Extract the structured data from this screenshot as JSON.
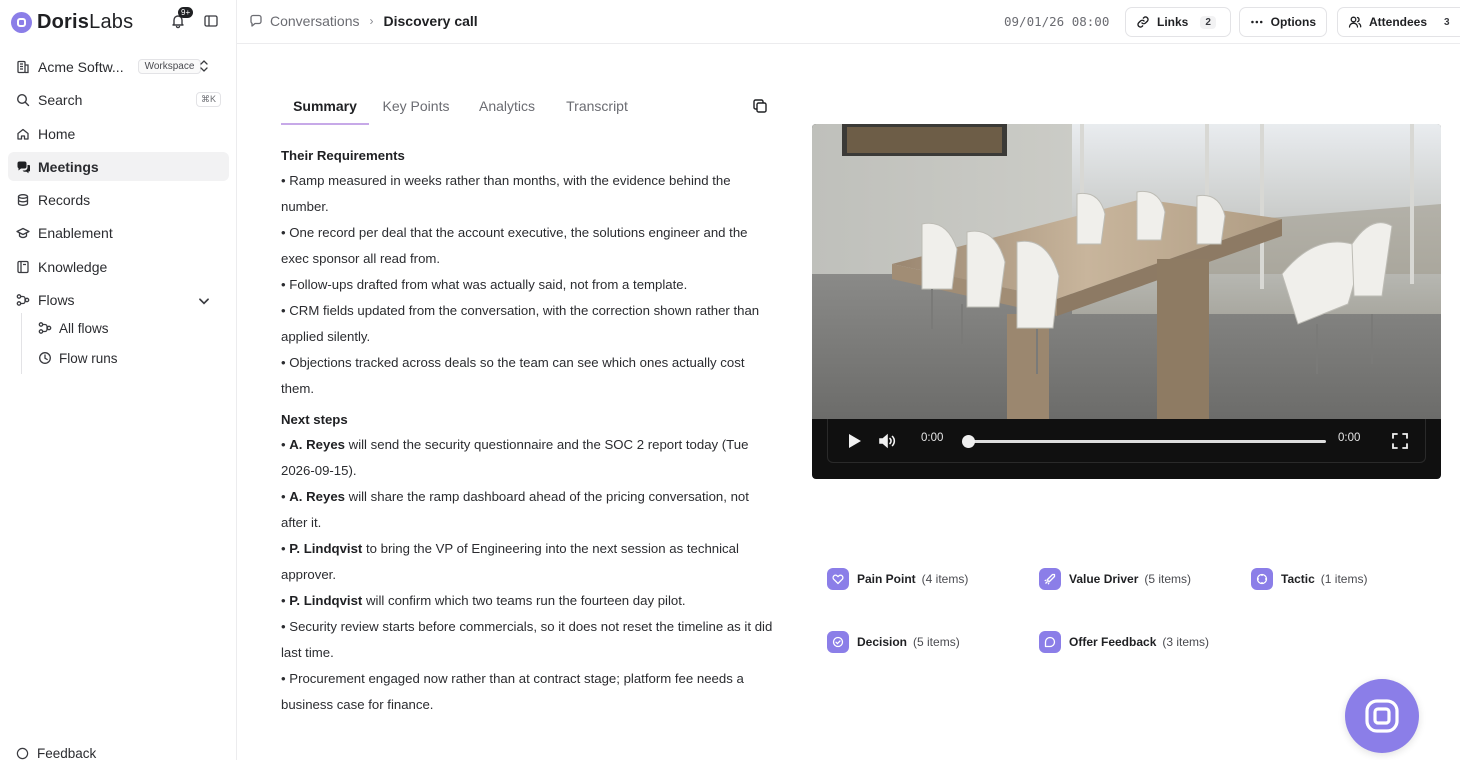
{
  "brand": {
    "name_bold": "Doris",
    "name_rest": "Labs",
    "notifications_badge": "9+"
  },
  "sidebar": {
    "workspace": {
      "name": "Acme Softw...",
      "tag": "Workspace"
    },
    "search": {
      "label": "Search",
      "shortcut": "⌘K"
    },
    "items": [
      {
        "label": "Home",
        "icon": "home-icon"
      },
      {
        "label": "Meetings",
        "icon": "chat-bubbles-icon",
        "active": true
      },
      {
        "label": "Records",
        "icon": "database-icon"
      },
      {
        "label": "Enablement",
        "icon": "graduation-cap-icon"
      },
      {
        "label": "Knowledge",
        "icon": "book-icon"
      },
      {
        "label": "Flows",
        "icon": "workflow-icon",
        "expanded": true
      }
    ],
    "flows_children": [
      {
        "label": "All flows",
        "icon": "workflow-icon"
      },
      {
        "label": "Flow runs",
        "icon": "clock-icon"
      }
    ],
    "feedback": "Feedback"
  },
  "topbar": {
    "breadcrumb_parent": "Conversations",
    "breadcrumb_current": "Discovery call",
    "timestamp": "09/01/26 08:00",
    "links": {
      "label": "Links",
      "count": "2"
    },
    "options": {
      "label": "Options"
    },
    "attendees": {
      "label": "Attendees",
      "count": "3"
    }
  },
  "tabs": [
    "Summary",
    "Key Points",
    "Analytics",
    "Transcript"
  ],
  "summary": {
    "requirements_title": "Their Requirements",
    "requirements": [
      "• Ramp measured in weeks rather than months, with the evidence behind the number.",
      "• One record per deal that the account executive, the solutions engineer and the exec sponsor all read from.",
      "• Follow-ups drafted from what was actually said, not from a template.",
      "• CRM fields updated from the conversation, with the correction shown rather than applied silently.",
      "• Objections tracked across deals so the team can see which ones actually cost them."
    ],
    "next_steps_title": "Next steps",
    "next_steps": [
      {
        "owner": "A. Reyes",
        "text": " will send the security questionnaire and the SOC 2 report today (Tue 2026-09-15)."
      },
      {
        "owner": "A. Reyes",
        "text": " will share the ramp dashboard ahead of the pricing conversation, not after it."
      },
      {
        "owner": "P. Lindqvist",
        "text": " to bring the VP of Engineering into the next session as technical approver."
      },
      {
        "owner": "P. Lindqvist",
        "text": " will confirm which two teams run the fourteen day pilot."
      },
      {
        "owner": "",
        "text": "Security review starts before commercials, so it does not reset the timeline as it did last time."
      },
      {
        "owner": "",
        "text": "Procurement engaged now rather than at contract stage; platform fee needs a business case for finance."
      }
    ]
  },
  "video": {
    "current_time": "0:00",
    "duration": "0:00",
    "progress": 0
  },
  "categories": [
    {
      "name": "Pain Point",
      "count": "(4 items)",
      "icon": "heart-icon"
    },
    {
      "name": "Value Driver",
      "count": "(5 items)",
      "icon": "rocket-icon"
    },
    {
      "name": "Tactic",
      "count": "(1 items)",
      "icon": "target-icon"
    },
    {
      "name": "Decision",
      "count": "(5 items)",
      "icon": "check-circle-icon"
    },
    {
      "name": "Offer Feedback",
      "count": "(3 items)",
      "icon": "message-icon"
    }
  ],
  "colors": {
    "accent": "#8b7ee8",
    "tab_underline": "#c7a9e8",
    "active_nav_bg": "#f2f2f3"
  }
}
